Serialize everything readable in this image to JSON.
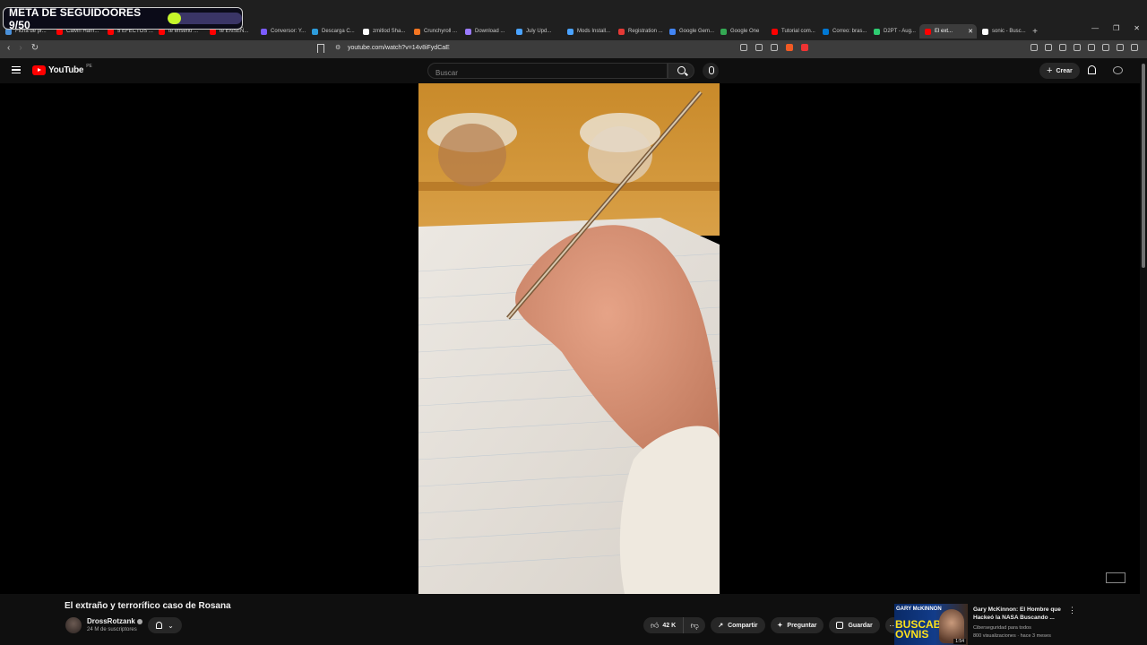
{
  "overlay": {
    "goal_text": "META DE SEGUIDOORES 9/50",
    "progress": 0.18
  },
  "browser": {
    "tabs": [
      {
        "label": "Ficha de pr...",
        "color": "#4a90d9"
      },
      {
        "label": "Calvin Harri...",
        "color": "#ff0000"
      },
      {
        "label": "5 EFECTOS ...",
        "color": "#ff0000"
      },
      {
        "label": "te enseño ...",
        "color": "#ff0000"
      },
      {
        "label": "te ENSEÑ...",
        "color": "#ff0000"
      },
      {
        "label": "Conversor: Y...",
        "color": "#7b5cff"
      },
      {
        "label": "Descarga C...",
        "color": "#2d9cdb"
      },
      {
        "label": "zmitlod Sha...",
        "color": "#ffffff"
      },
      {
        "label": "Crunchyroll ...",
        "color": "#f47521"
      },
      {
        "label": "Download ...",
        "color": "#9b7bff"
      },
      {
        "label": "July Upd...",
        "color": "#4aa3ff"
      },
      {
        "label": "Mods Install...",
        "color": "#4aa3ff"
      },
      {
        "label": "Registration ...",
        "color": "#e53935"
      },
      {
        "label": "Google Gem...",
        "color": "#4285f4"
      },
      {
        "label": "Google One",
        "color": "#34a853"
      },
      {
        "label": "Tutorial com...",
        "color": "#ff0000"
      },
      {
        "label": "Correo: bras...",
        "color": "#0078d4"
      },
      {
        "label": "D2PT - Aug...",
        "color": "#2ecc71"
      },
      {
        "label": "El ext...",
        "color": "#ff0000"
      },
      {
        "label": "sonic - Busc...",
        "color": "#ffffff"
      }
    ],
    "active_tab_index": 18,
    "url": "youtube.com/watch?v=14v8iFydCaE"
  },
  "youtube": {
    "logo_text": "YouTube",
    "country_code": "PE",
    "search_placeholder": "Buscar",
    "create_label": "Crear",
    "video_title": "El extraño y terrorífico caso de Rosana",
    "channel_name": "DrossRotzank",
    "subscribers": "24 M de suscriptores",
    "likes": "42 K",
    "share_label": "Compartir",
    "ask_label": "Preguntar",
    "save_label": "Guardar",
    "recommendation": {
      "thumb_top_text": "GARY McKINNON",
      "thumb_big_text_1": "BUSCABA",
      "thumb_big_text_2": "OVNIS",
      "duration": "1:54",
      "title": "Gary McKinnon: El Hombre que Hackeó la NASA Buscando ...",
      "channel": "Ciberseguridad para todos",
      "meta": "800 visualizaciones · hace 3 meses"
    }
  }
}
